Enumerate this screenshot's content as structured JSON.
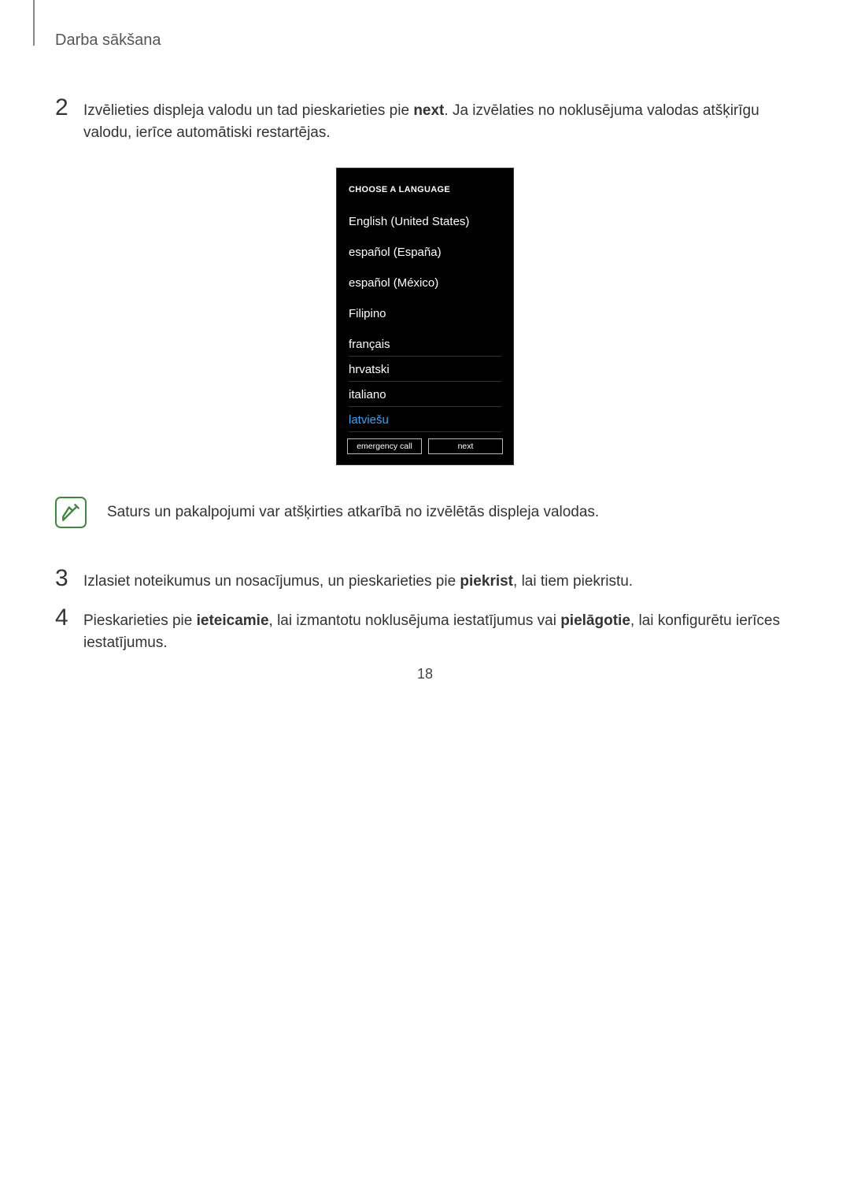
{
  "header": {
    "title": "Darba sākšana"
  },
  "step2": {
    "num": "2",
    "text_a": "Izvēlieties displeja valodu un tad pieskarieties pie ",
    "bold_a": "next",
    "text_b": ". Ja izvēlaties no noklusējuma valodas atšķirīgu valodu, ierīce automātiski restartējas."
  },
  "phone": {
    "title": "CHOOSE A LANGUAGE",
    "langs": [
      "English (United States)",
      "español (España)",
      "español (México)",
      "Filipino",
      "français",
      "hrvatski",
      "italiano",
      "latviešu"
    ],
    "selected_index": 7,
    "btn_emergency": "emergency call",
    "btn_next": "next"
  },
  "note": {
    "text": "Saturs un pakalpojumi var atšķirties atkarībā no izvēlētās displeja valodas."
  },
  "step3": {
    "num": "3",
    "text_a": "Izlasiet noteikumus un nosacījumus, un pieskarieties pie ",
    "bold_a": "piekrist",
    "text_b": ", lai tiem piekristu."
  },
  "step4": {
    "num": "4",
    "text_a": "Pieskarieties pie ",
    "bold_a": "ieteicamie",
    "text_b": ", lai izmantotu noklusējuma iestatījumus vai ",
    "bold_b": "pielāgotie",
    "text_c": ", lai konfigurētu ierīces iestatījumus."
  },
  "page_number": "18"
}
